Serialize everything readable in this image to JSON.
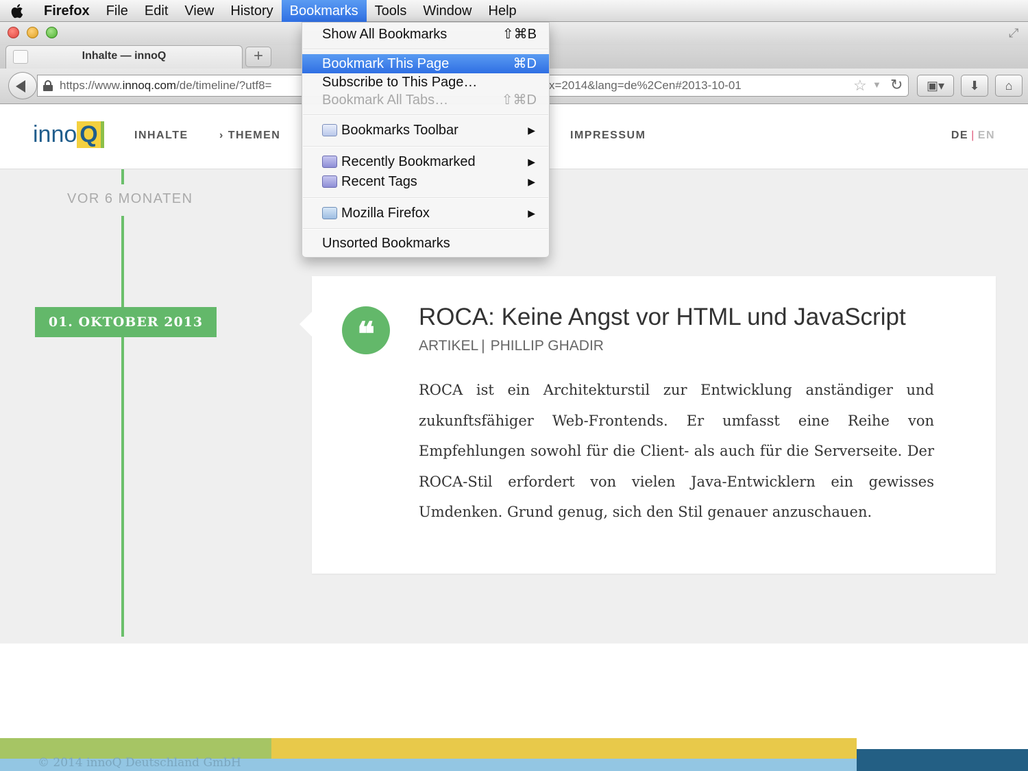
{
  "menubar": {
    "items": [
      {
        "label": "Firefox"
      },
      {
        "label": "File"
      },
      {
        "label": "Edit"
      },
      {
        "label": "View"
      },
      {
        "label": "History"
      },
      {
        "label": "Bookmarks"
      },
      {
        "label": "Tools"
      },
      {
        "label": "Window"
      },
      {
        "label": "Help"
      }
    ],
    "active": "Bookmarks"
  },
  "tabs": {
    "items": [
      {
        "title": "Inhalte — innoQ"
      }
    ],
    "new_tab_label": "+"
  },
  "navbar": {
    "url_left_prefix": "https://www.",
    "url_left_domain": "innoq.com",
    "url_left_suffix": "/de/timeline/?utf8=",
    "url_right": "x=2014&lang=de%2Cen#2013-10-01"
  },
  "dropdown": {
    "items": [
      {
        "label": "Show All Bookmarks",
        "shortcut": "⇧⌘B"
      },
      {
        "label": "Bookmark This Page",
        "shortcut": "⌘D",
        "highlighted": true
      },
      {
        "label": "Subscribe to This Page…"
      },
      {
        "label": "Bookmark All Tabs…",
        "shortcut": "⇧⌘D",
        "disabled": true
      },
      {
        "label": "Bookmarks Toolbar",
        "submenu": true,
        "icon": "bookmarks-toolbar-icon"
      },
      {
        "label": "Recently Bookmarked",
        "submenu": true,
        "icon": "smart-folder-icon"
      },
      {
        "label": "Recent Tags",
        "submenu": true,
        "icon": "smart-folder-icon"
      },
      {
        "label": "Mozilla Firefox",
        "submenu": true,
        "icon": "folder-icon"
      },
      {
        "label": "Unsorted Bookmarks"
      }
    ]
  },
  "site": {
    "logo_text": "inno",
    "logo_q": "Q",
    "nav": [
      {
        "label": "INHALTE"
      },
      {
        "label": "› THEMEN"
      },
      {
        "label": "IMPRESSUM"
      }
    ],
    "lang": {
      "de": "DE",
      "sep": "|",
      "en": "EN"
    }
  },
  "timeline": {
    "ago_label": "VOR 6 MONATEN",
    "date_label": "01. OKTOBER 2013"
  },
  "article": {
    "quote_glyph": "❝",
    "title": "ROCA: Keine Angst vor HTML und JavaScript",
    "type": "ARTIKEL",
    "divider": "|",
    "author": "PHILLIP GHADIR",
    "text": "ROCA ist ein Architekturstil zur Entwicklung anständiger und zukunftsfähiger Web-Frontends. Er umfasst eine Reihe von Empfehlungen sowohl für die Client- als auch für die Serverseite. Der ROCA-Stil erfordert von vielen Java-Entwicklern ein gewisses Umdenken. Grund genug, sich den Stil genauer anzuschauen."
  },
  "footer": {
    "copyright": "© 2014 innoQ Deutschland GmbH"
  },
  "colors": {
    "menu_highlight": "#3a7ee8",
    "timeline_green": "#63b86a",
    "logo_blue": "#1f5d8c",
    "logo_yellow": "#f4d03f"
  }
}
